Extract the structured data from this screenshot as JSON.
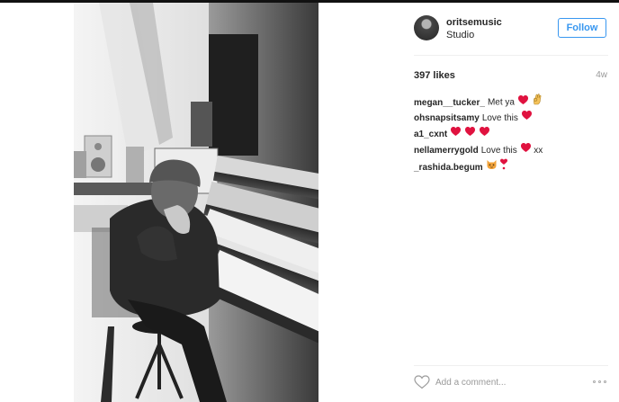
{
  "post": {
    "author": {
      "username": "oritsemusic",
      "location": "Studio",
      "avatar_icon": "user-avatar"
    },
    "follow_label": "Follow",
    "likes_text": "397 likes",
    "time_ago": "4w",
    "comments": [
      {
        "author": "megan__tucker_",
        "text": "Met ya",
        "emojis": [
          "red-heart",
          "ok-hand"
        ]
      },
      {
        "author": "ohsnapsitsamy",
        "text": "Love this",
        "emojis": [
          "red-heart"
        ]
      },
      {
        "author": "a1_cxnt",
        "text": "",
        "emojis": [
          "red-heart",
          "red-heart",
          "red-heart"
        ]
      },
      {
        "author": "nellamerrygold",
        "text": "Love this",
        "emojis": [
          "red-heart"
        ],
        "suffix": "xx"
      },
      {
        "author": "_rashida.begum",
        "text": "",
        "emojis": [
          "cat-face",
          "heart-exclamation"
        ]
      }
    ],
    "add_comment_placeholder": "Add a comment...",
    "icons": {
      "like": "heart-outline-icon",
      "more": "more-options-icon"
    }
  },
  "colors": {
    "accent": "#3897f0",
    "text": "#262626",
    "muted": "#999999",
    "divider": "#efefef"
  }
}
